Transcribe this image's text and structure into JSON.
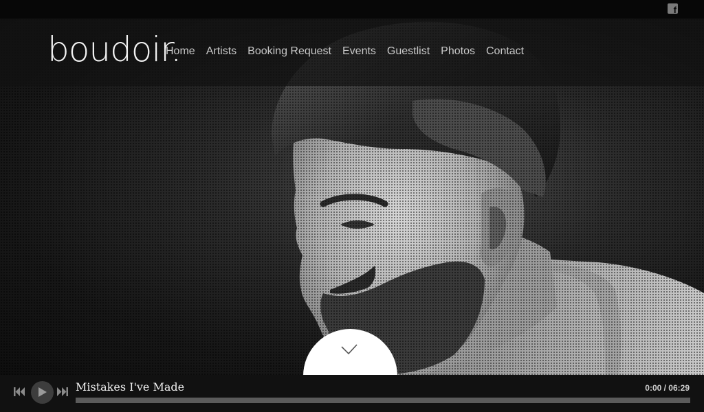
{
  "topbar": {
    "social_icon": "facebook-icon"
  },
  "logo": {
    "text": "boudoir."
  },
  "nav": {
    "items": [
      {
        "label": "Home"
      },
      {
        "label": "Artists"
      },
      {
        "label": "Booking Request"
      },
      {
        "label": "Events"
      },
      {
        "label": "Guestlist"
      },
      {
        "label": "Photos"
      },
      {
        "label": "Contact"
      }
    ]
  },
  "hero": {
    "image": "monochrome-portrait-bearded-man-profile",
    "scroll_icon": "chevron-down-icon"
  },
  "player": {
    "track_title": "Mistakes I've Made",
    "time": "0:00 / 06:29",
    "progress": 0,
    "icons": [
      "previous-icon",
      "play-icon",
      "next-icon"
    ]
  },
  "colors": {
    "background": "#0d0d0d",
    "header": "#121212",
    "text": "#c8c8c8",
    "accent": "#ffffff"
  }
}
